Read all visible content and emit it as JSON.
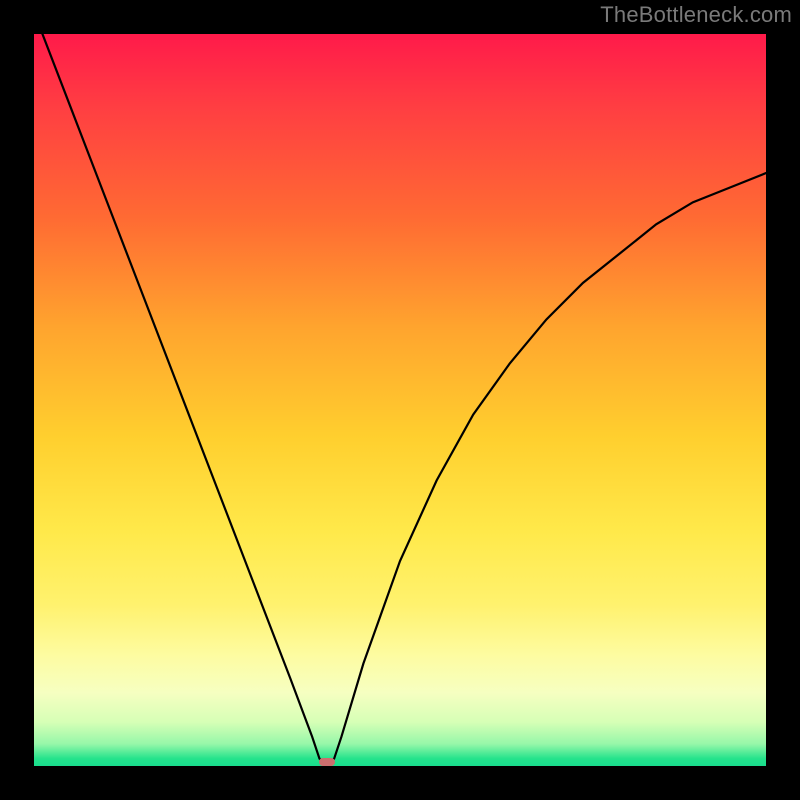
{
  "watermark": "TheBottleneck.com",
  "colors": {
    "frame": "#000000",
    "curve": "#000000",
    "marker": "#cc6e6e",
    "gradient_stops": [
      "#ff1a4a",
      "#ff3e42",
      "#ff6a33",
      "#ffa42e",
      "#ffcf2e",
      "#ffe94a",
      "#fff26e",
      "#fdfca2",
      "#f6ffb6",
      "#96f7a9",
      "#24e38c"
    ]
  },
  "chart_data": {
    "type": "line",
    "title": "",
    "xlabel": "",
    "ylabel": "",
    "xlim": [
      0,
      100
    ],
    "ylim": [
      0,
      100
    ],
    "grid": false,
    "legend": false,
    "series": [
      {
        "name": "bottleneck-curve",
        "x": [
          0,
          5,
          10,
          15,
          20,
          25,
          30,
          35,
          38,
          39,
          40,
          41,
          42,
          45,
          50,
          55,
          60,
          65,
          70,
          75,
          80,
          85,
          90,
          95,
          100
        ],
        "y": [
          103,
          90,
          77,
          64,
          51,
          38,
          25,
          12,
          4,
          1,
          0,
          1,
          4,
          14,
          28,
          39,
          48,
          55,
          61,
          66,
          70,
          74,
          77,
          79,
          81
        ]
      }
    ],
    "marker": {
      "x": 40,
      "y": 0,
      "width_pct": 2.2,
      "height_pct": 1.2
    }
  }
}
